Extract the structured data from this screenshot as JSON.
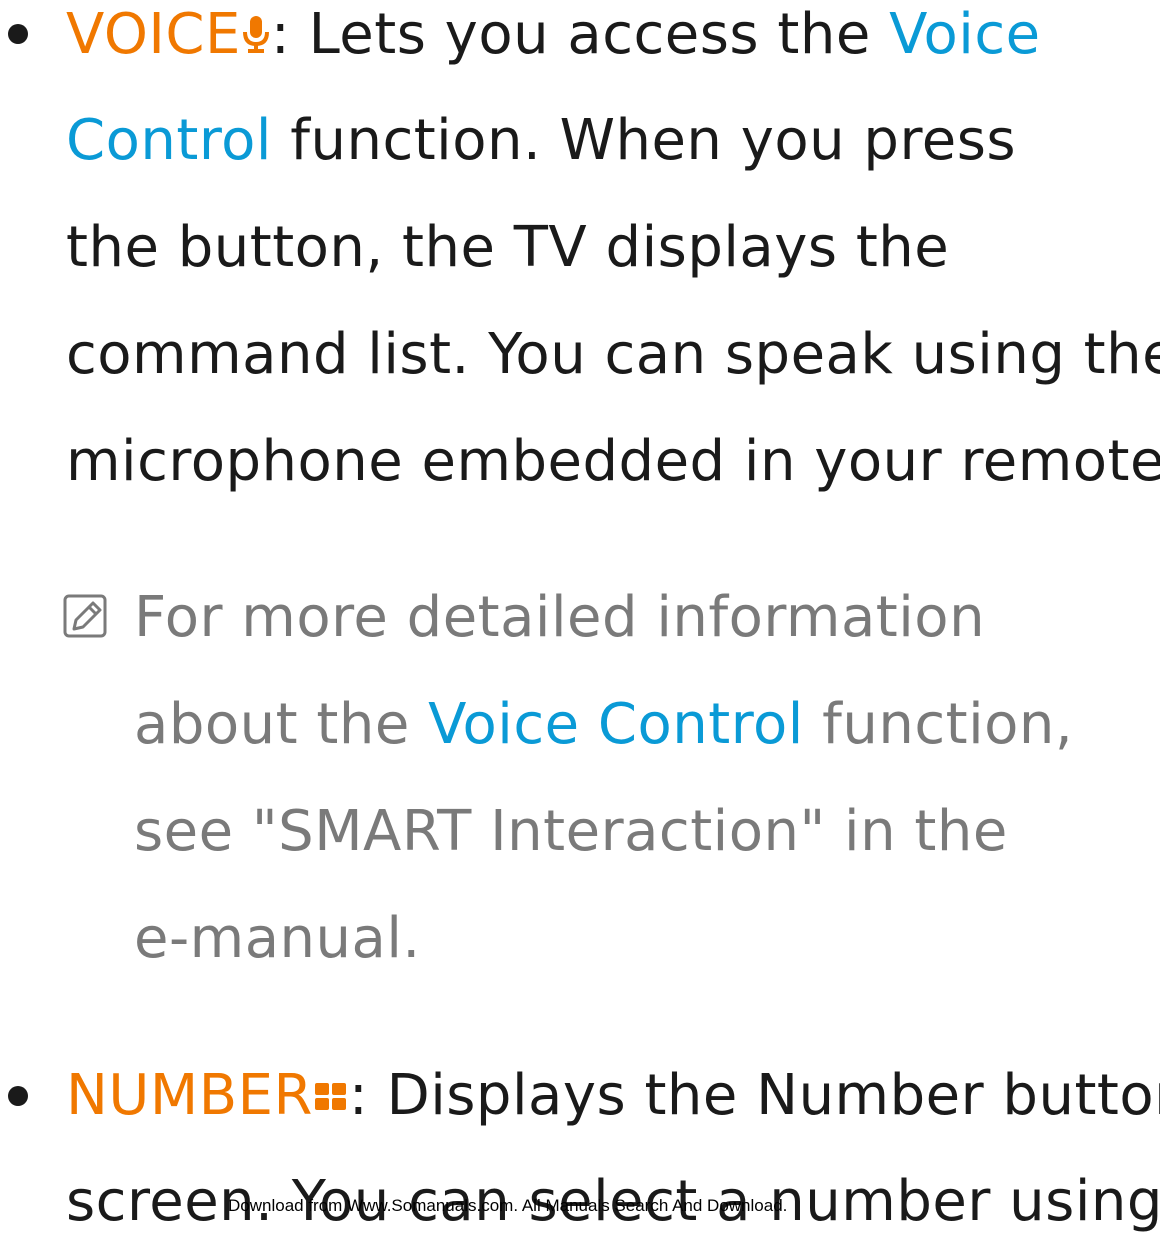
{
  "colors": {
    "orange": "#f07800",
    "blue": "#0a9ad6",
    "gray": "#7a7a7a",
    "text": "#1a1a1a"
  },
  "voice": {
    "label": "VOICE",
    "icon": "microphone-icon",
    "line1_text": ": Lets you access the ",
    "line1_link": "Voice",
    "line2_link": "Control",
    "line2_text": " function. When you press",
    "line3": "the button, the TV displays the",
    "line4": "command list. You can speak using the",
    "line5": "microphone embedded in your remote."
  },
  "note": {
    "icon": "note-pencil-icon",
    "line1": "For more detailed information",
    "line2_pre": "about the ",
    "line2_link": "Voice Control",
    "line2_post": " function,",
    "line3": "see \"SMART Interaction\" in the",
    "line4": "e-manual."
  },
  "number": {
    "label": "NUMBER",
    "icon": "number-grid-icon",
    "line1_text": ": Displays the Number button",
    "line2": "screen. You can select a number using"
  },
  "footer": "Download from Www.Somanuals.com. All Manuals Search And Download."
}
